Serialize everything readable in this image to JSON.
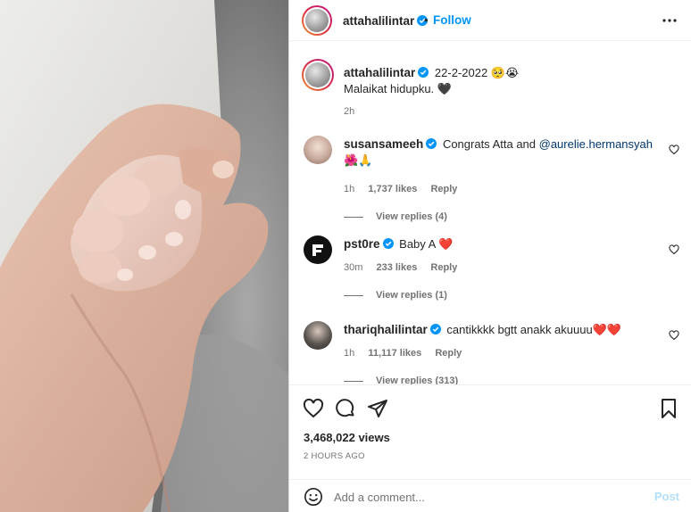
{
  "post": {
    "author": "attahalilintar",
    "follow_label": "Follow",
    "dot": "•",
    "caption_date": "22-2-2022 🥺😭",
    "caption_text": "Malaikat hidupku. 🖤",
    "caption_age": "2h"
  },
  "comments": [
    {
      "user": "susansameeh",
      "text_before": "Congrats Atta and ",
      "mention": "@aurelie.hermansyah",
      "text_after": " 🌺🙏",
      "age": "1h",
      "likes": "1,737 likes",
      "reply_label": "Reply",
      "view_replies": "View replies (4)"
    },
    {
      "user": "pst0re",
      "text": "Baby A ❤️",
      "age": "30m",
      "likes": "233 likes",
      "reply_label": "Reply",
      "view_replies": "View replies (1)"
    },
    {
      "user": "thariqhalilintar",
      "text": "cantikkkk bgtt anakk akuuuu❤️❤️",
      "age": "1h",
      "likes": "11,117 likes",
      "reply_label": "Reply",
      "view_replies": "View replies (313)"
    }
  ],
  "footer": {
    "views": "3,468,022 views",
    "timestamp": "2 HOURS AGO",
    "comment_placeholder": "Add a comment...",
    "post_label": "Post"
  },
  "icons": {
    "like": "heart-icon",
    "comment": "comment-icon",
    "share": "share-icon",
    "save": "bookmark-icon",
    "more": "more-icon",
    "emoji": "emoji-icon",
    "verified": "verified-badge-icon"
  },
  "colors": {
    "accent": "#0095f6",
    "post_disabled": "#b2dffc",
    "heart": "#ed4956"
  }
}
